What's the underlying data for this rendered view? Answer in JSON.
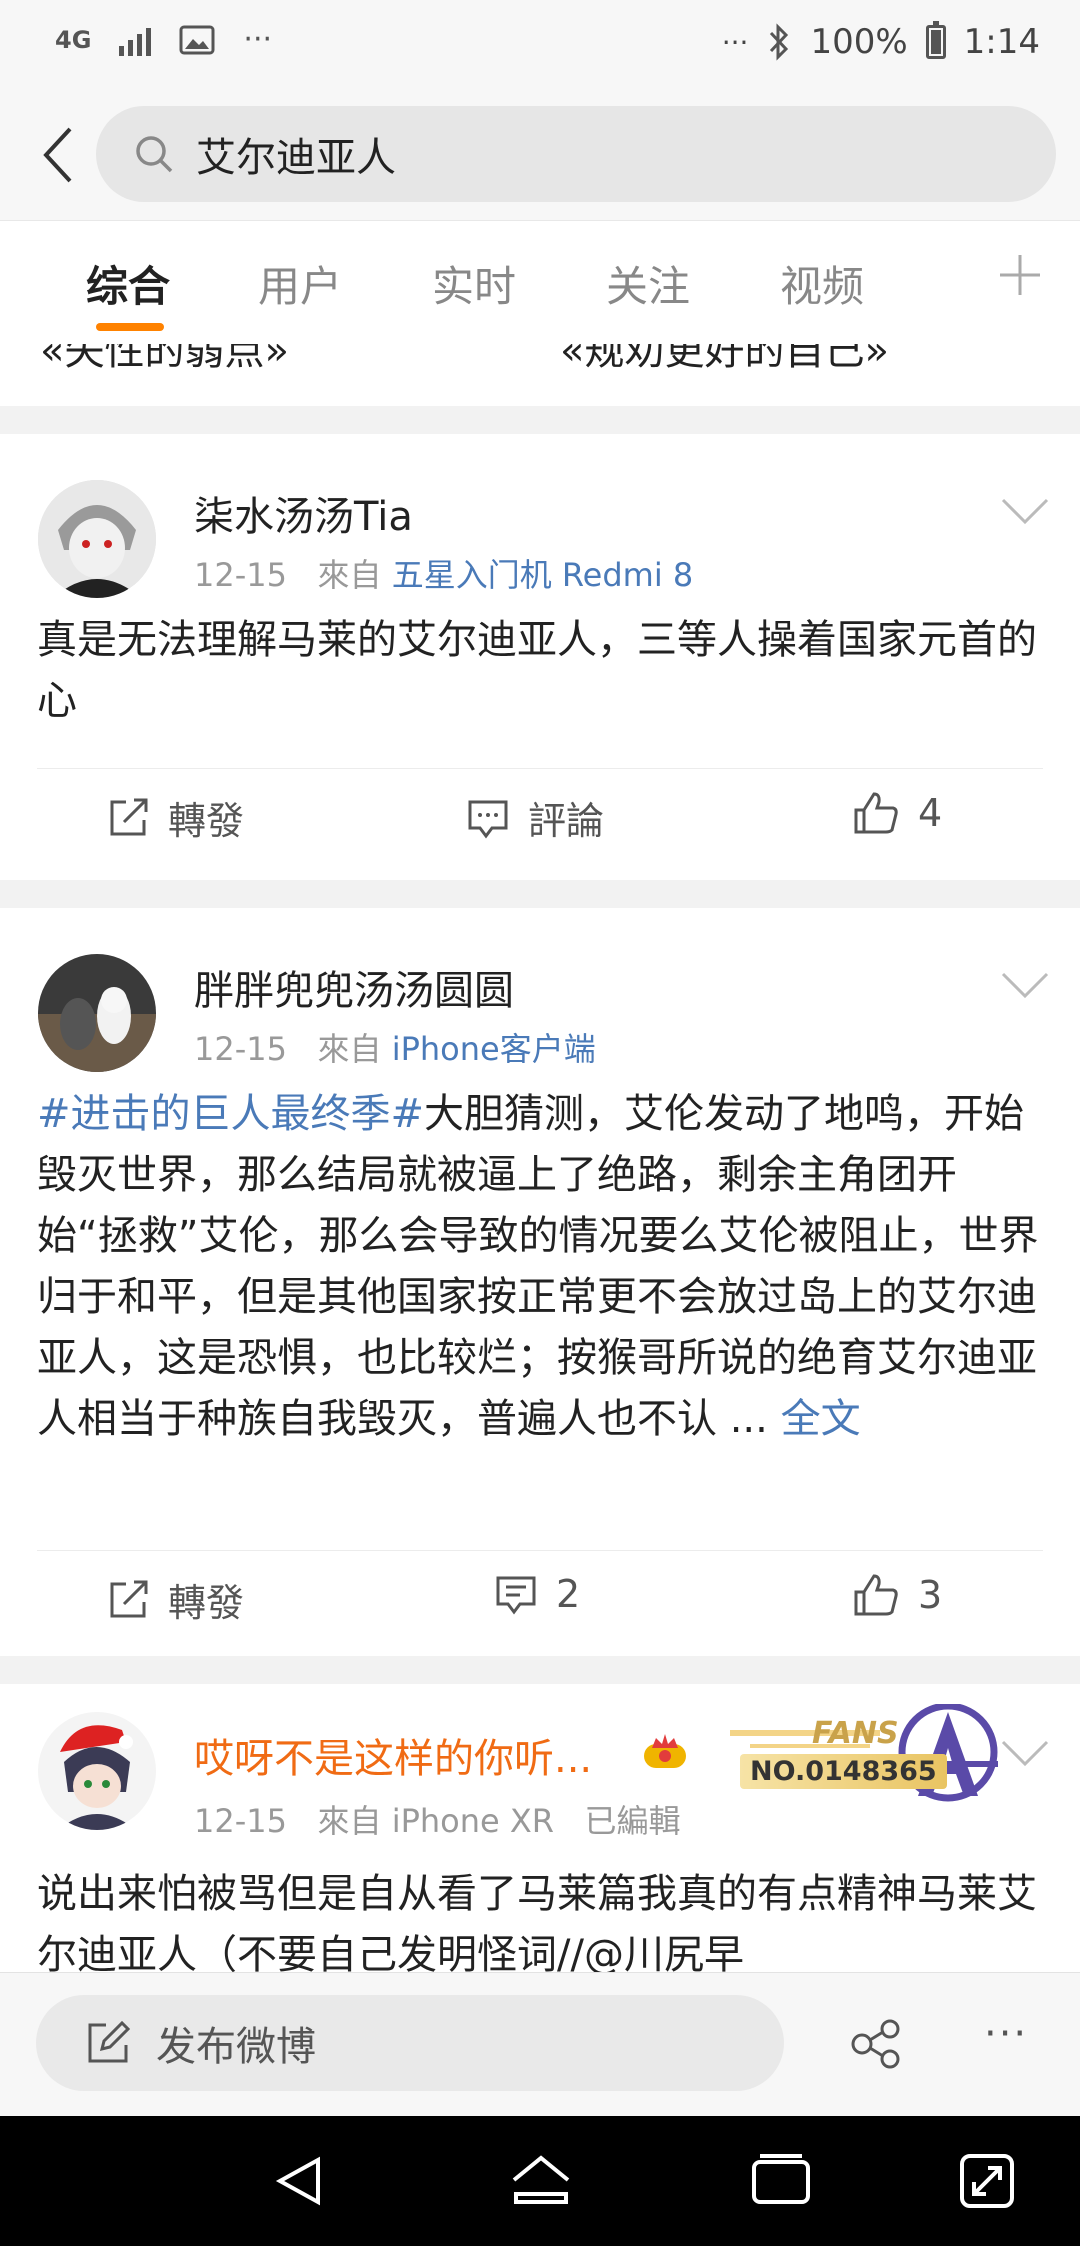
{
  "status_bar": {
    "network": "4G",
    "battery": "100%",
    "time": "1:14",
    "more": "···"
  },
  "search": {
    "query": "艾尔迪亚人"
  },
  "tabs": [
    {
      "label": "综合",
      "active": true
    },
    {
      "label": "用户"
    },
    {
      "label": "实时"
    },
    {
      "label": "关注"
    },
    {
      "label": "视频"
    }
  ],
  "clipped_text": {
    "left": "«失性的弱点»",
    "right": "«规劝更好的自己»"
  },
  "posts": [
    {
      "username": "柒水汤汤Tia",
      "date": "12-15",
      "from": "來自",
      "source": "五星入门机 Redmi 8",
      "text": "真是无法理解马莱的艾尔迪亚人，三等人操着国家元首的心",
      "repost": "轉發",
      "comment": "評論",
      "likes": "4"
    },
    {
      "username": "胖胖兜兜汤汤圆圆",
      "date": "12-15",
      "from": "來自",
      "source": "iPhone客户端",
      "tag": "#进击的巨人最终季#",
      "text": "大胆猜测，艾伦发动了地鸣，开始毁灭世界，那么结局就被逼上了绝路，剩余主角团开始“拯救”艾伦，那么会导致的情况要么艾伦被阻止，世界归于和平，但是其他国家按正常更不会放过岛上的艾尔迪亚人，这是恐惧，也比较烂；按猴哥所说的绝育艾尔迪亚人相当于种族自我毁灭，普遍人也不认 ...",
      "more": "全文",
      "repost": "轉發",
      "comments": "2",
      "likes": "3"
    },
    {
      "username": "哎呀不是这样的你听...",
      "date": "12-15",
      "from": "來自",
      "source": "iPhone XR",
      "edited": "已編輯",
      "fans_label": "FANS",
      "fans_no": "NO.0148365",
      "text": "说出来怕被骂但是自从看了马莱篇我真的有点精神马莱艾尔迪亚人（不要自己发明怪词//@川尻早"
    }
  ],
  "compose": {
    "label": "发布微博"
  },
  "colors": {
    "accent": "#ff8200",
    "link": "#4a7ab8",
    "vip": "#f06b14"
  }
}
